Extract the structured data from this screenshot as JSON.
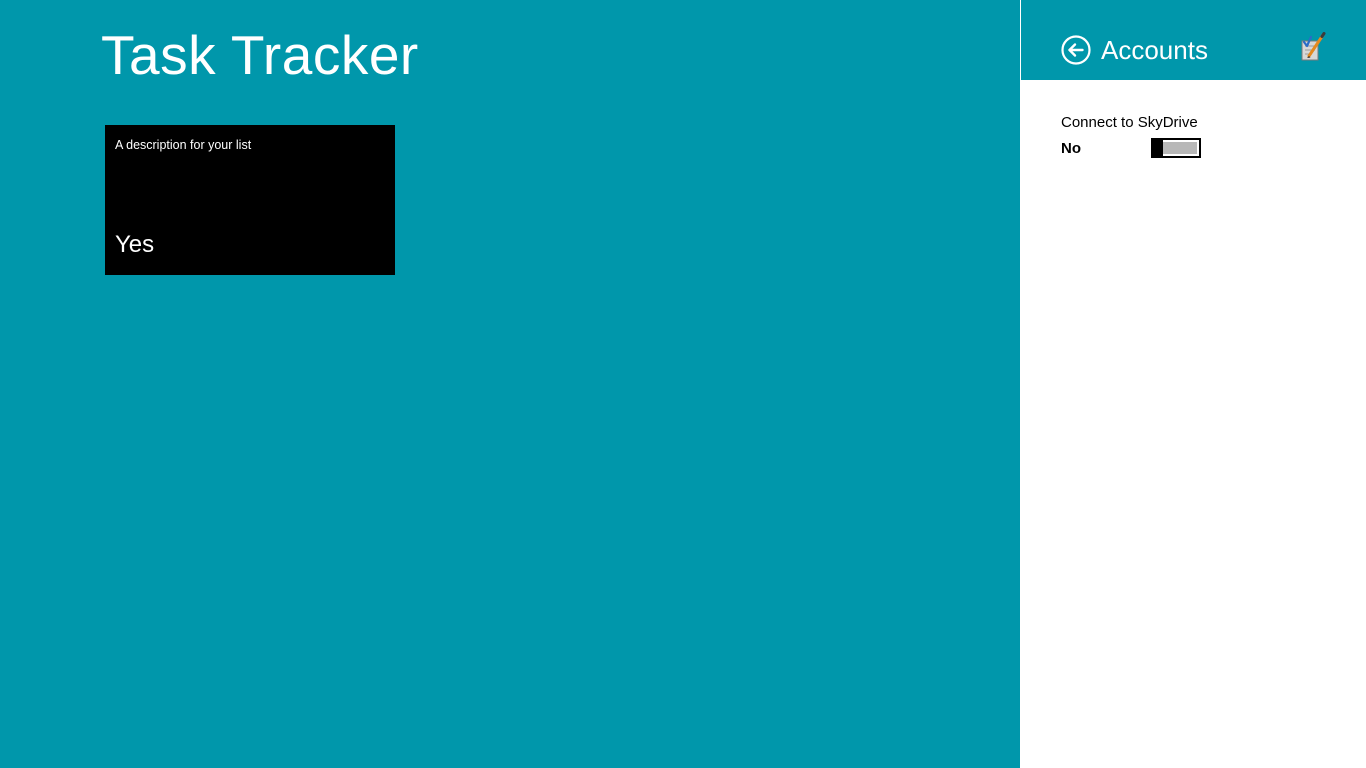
{
  "app": {
    "title": "Task Tracker",
    "background_color": "#0097ab"
  },
  "tile": {
    "description": "A description for your list",
    "value": "Yes",
    "background_color": "#000000"
  },
  "flyout": {
    "title": "Accounts",
    "header_color": "#0097ab",
    "back_icon": "back-arrow-circle-icon",
    "logo_icon": "app-logo-icon",
    "setting": {
      "label": "Connect to SkyDrive",
      "state_text": "No",
      "toggle_on": false
    }
  }
}
